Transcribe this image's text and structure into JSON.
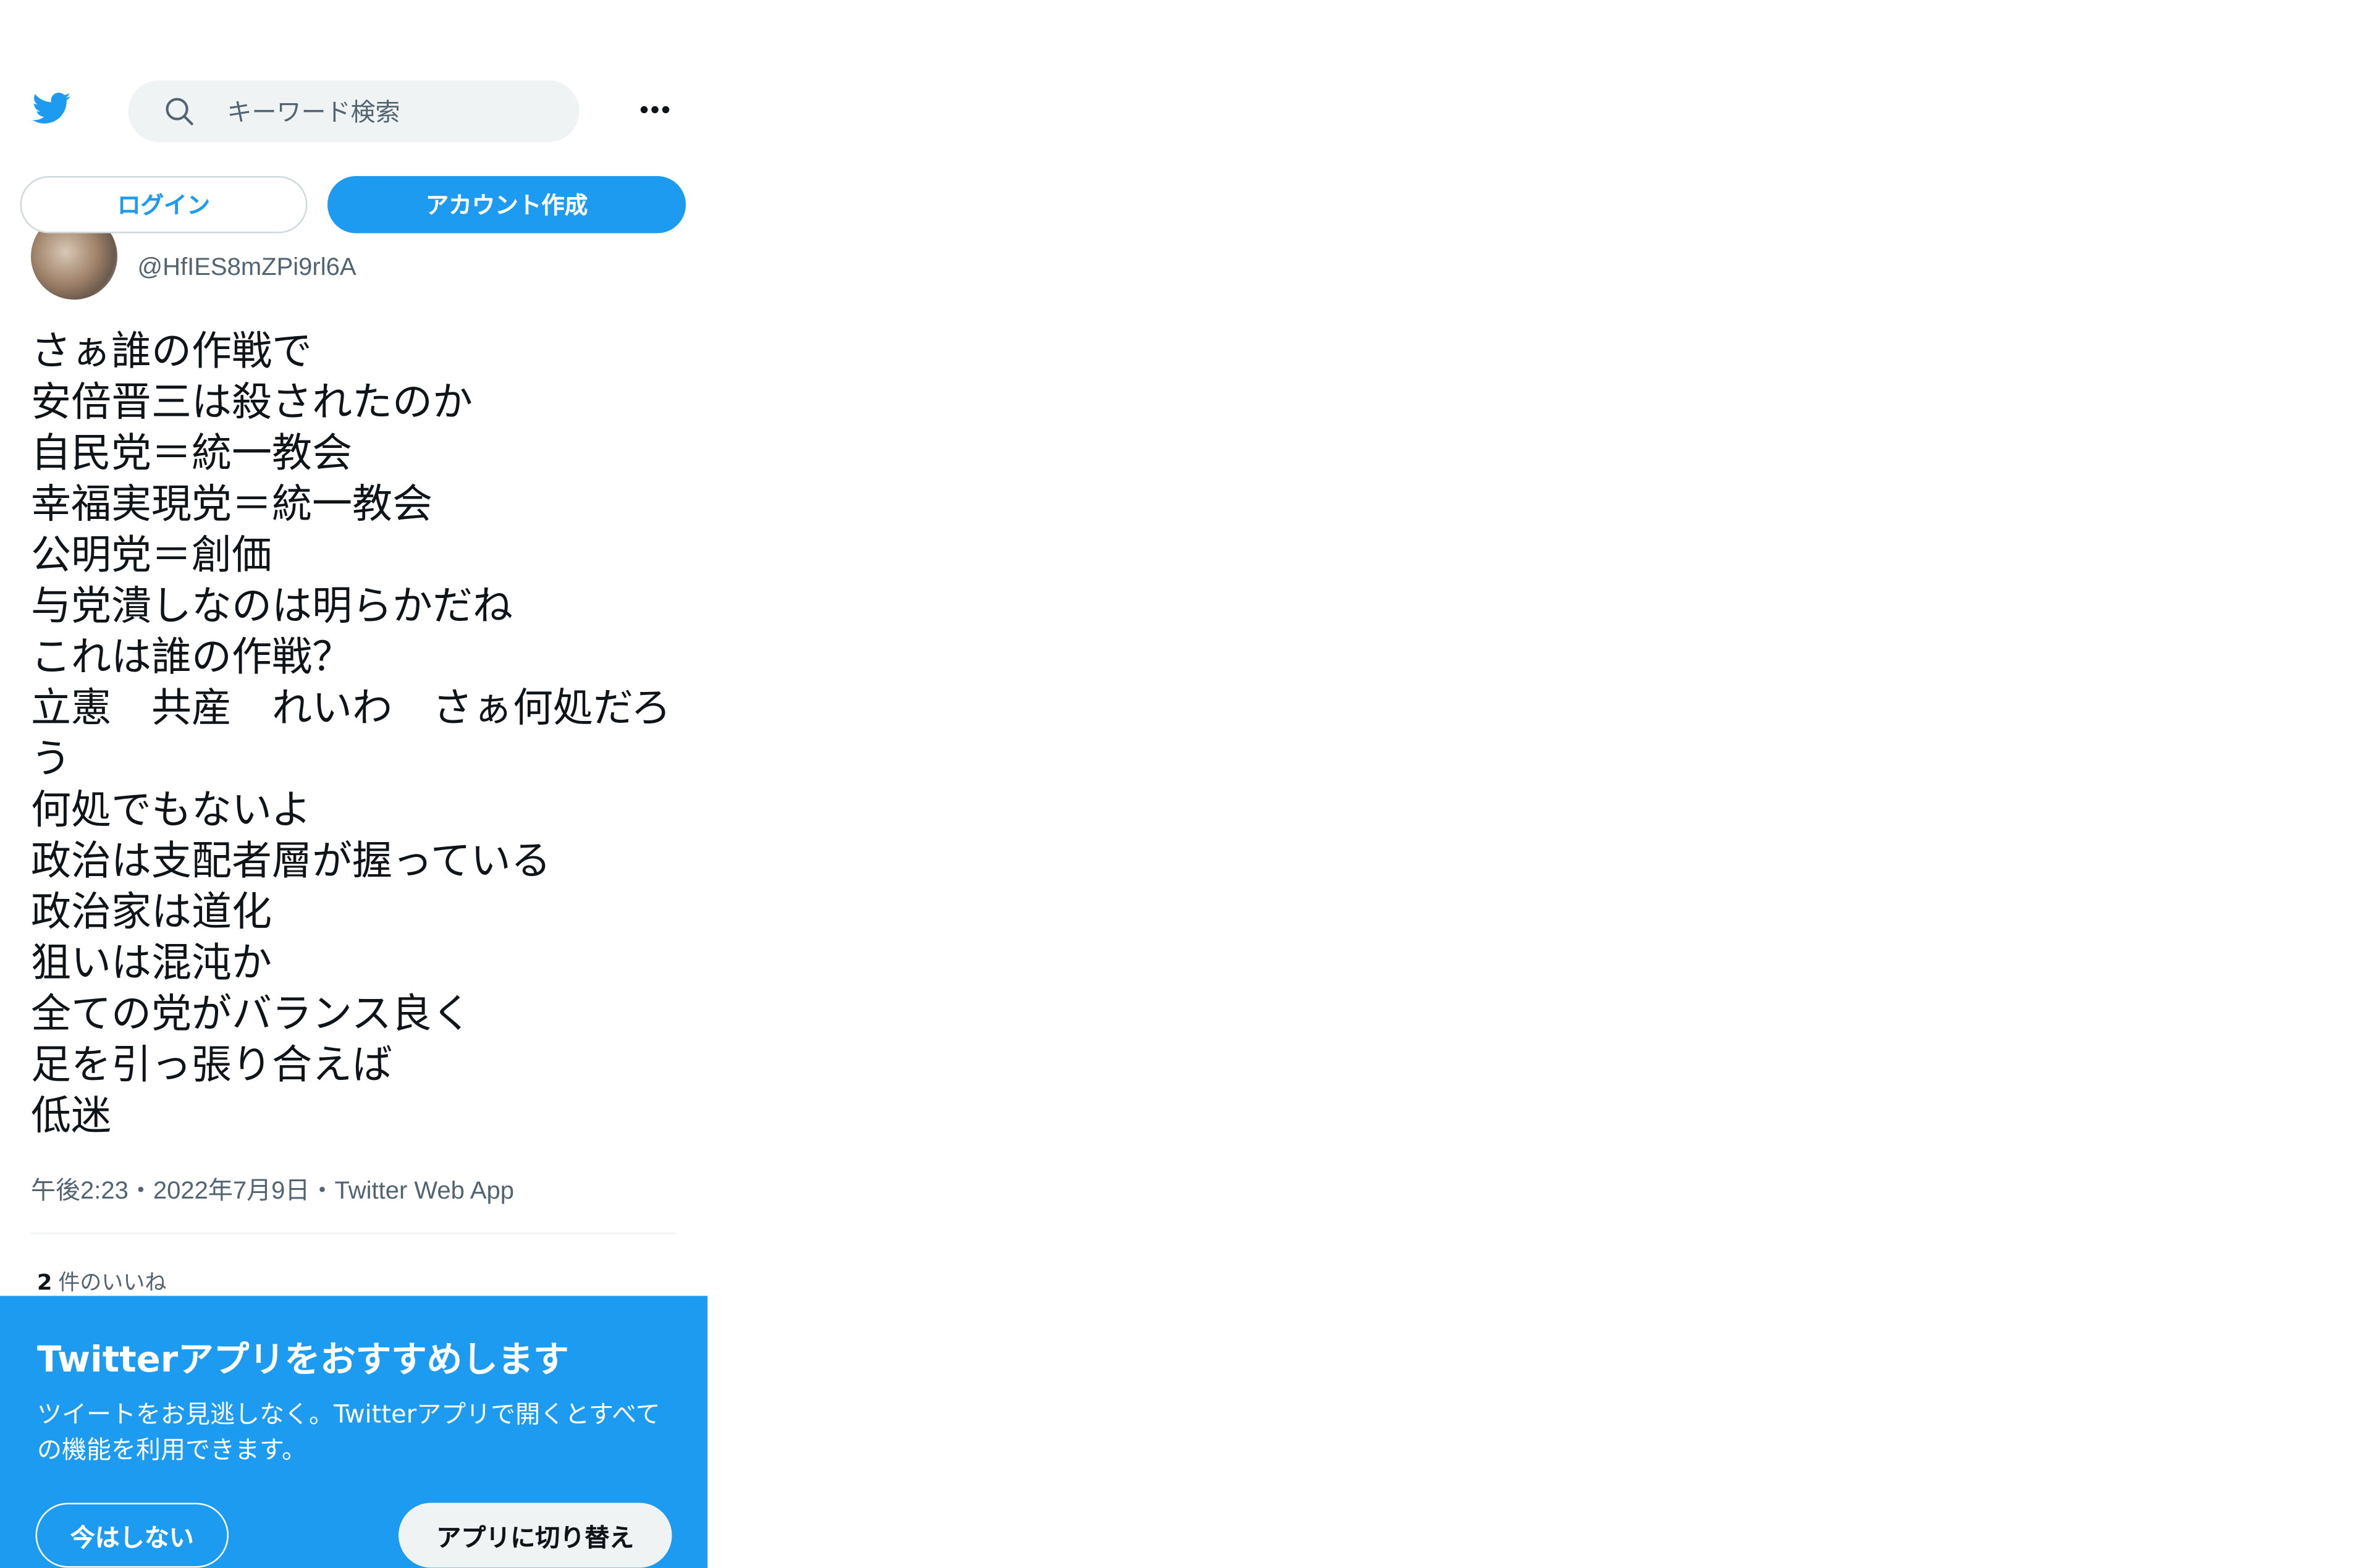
{
  "header": {
    "search_placeholder": "キーワード検索"
  },
  "auth": {
    "login_label": "ログイン",
    "signup_label": "アカウント作成"
  },
  "profile": {
    "handle": "@HfIES8mZPi9rl6A"
  },
  "tweet": {
    "lines": [
      "さぁ誰の作戦で",
      "安倍晋三は殺されたのか",
      "自民党＝統一教会",
      "幸福実現党＝統一教会",
      "公明党＝創価",
      "与党潰しなのは明らかだね",
      "これは誰の作戦？",
      "立憲　共産　れいわ　さぁ何処だろう",
      "何処でもないよ",
      "政治は支配者層が握っている",
      "政治家は道化",
      "狙いは混沌か",
      "全ての党がバランス良く",
      "足を引っ張り合えば",
      "低迷"
    ],
    "time": "午後2:23",
    "date": "2022年7月9日",
    "source": "Twitter Web App",
    "separator": "・",
    "likes_count": "2",
    "likes_label": "件のいいね"
  },
  "promo": {
    "title": "Twitterアプリをおすすめします",
    "description": "ツイートをお見逃しなく。Twitterアプリで開くとすべての機能を利用できます。",
    "not_now_label": "今はしない",
    "switch_label": "アプリに切り替え"
  },
  "colors": {
    "brand": "#1d9bf0",
    "text_primary": "#0f1419",
    "text_secondary": "#536471",
    "search_bg": "#eff3f4"
  },
  "icons": {
    "logo": "twitter-bird-icon",
    "search": "search-icon",
    "more": "more-icon"
  }
}
